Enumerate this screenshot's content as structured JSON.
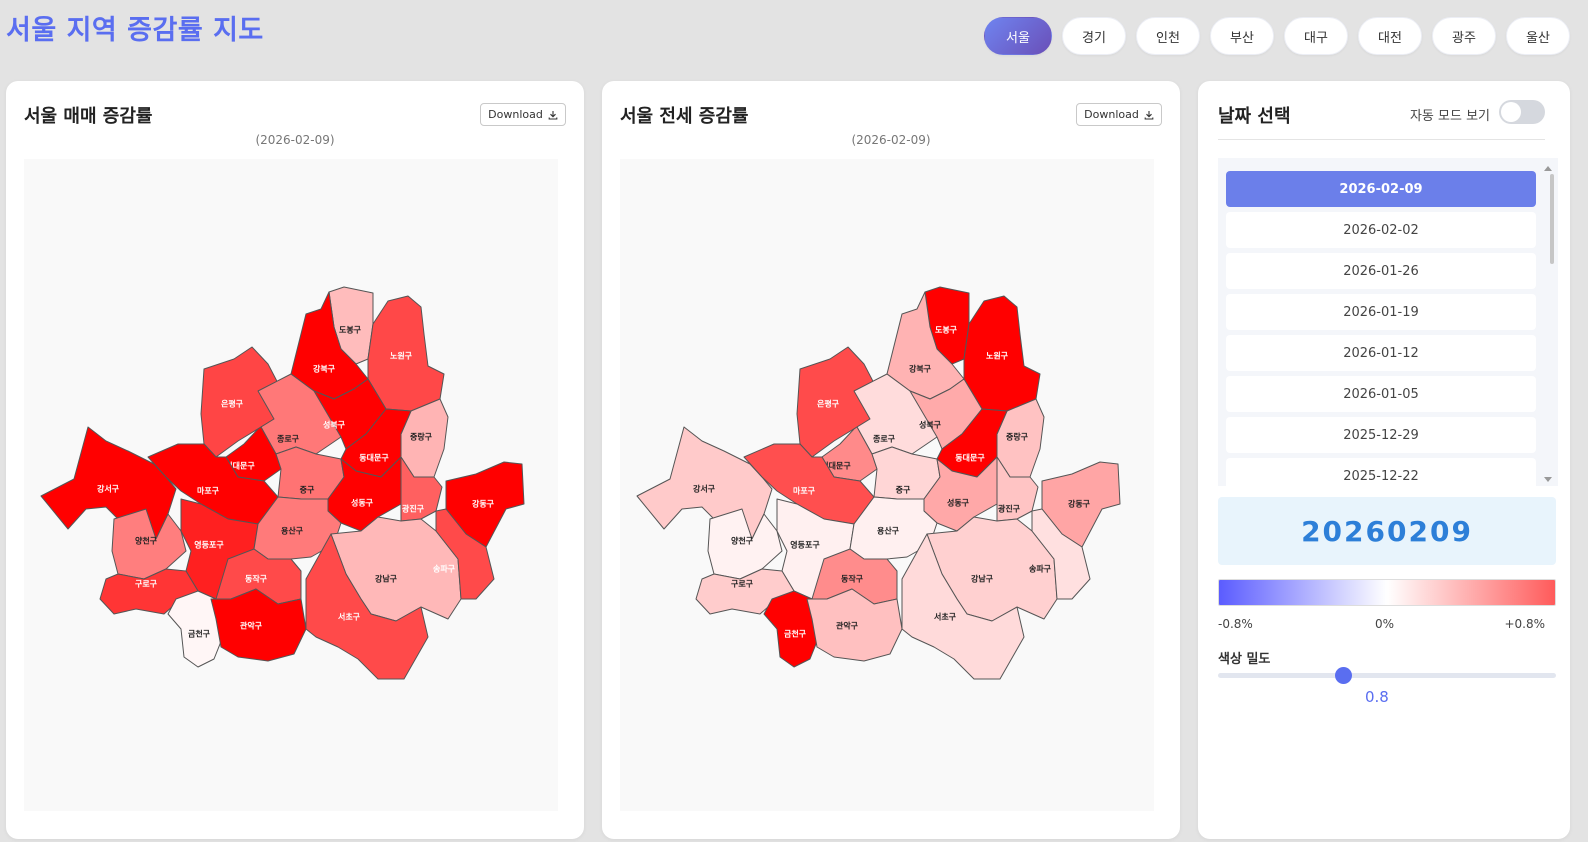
{
  "header": {
    "title": "서울 지역 증감률 지도",
    "regions": [
      "서울",
      "경기",
      "인천",
      "부산",
      "대구",
      "대전",
      "광주",
      "울산"
    ],
    "active_region": "서울"
  },
  "maps": [
    {
      "title": "서울 매매 증감률",
      "download_label": "Download",
      "date": "(2026-02-09)",
      "districts": [
        {
          "id": "dobong",
          "name": "도봉구",
          "color": "#ffbcbc",
          "label_color": "#222"
        },
        {
          "id": "nowon",
          "name": "노원구",
          "color": "#ff4848",
          "label_color": "#fff"
        },
        {
          "id": "gangbuk",
          "name": "강북구",
          "color": "#ff0000",
          "label_color": "#fff"
        },
        {
          "id": "eunpyeong",
          "name": "은평구",
          "color": "#ff4545",
          "label_color": "#fff"
        },
        {
          "id": "jongno",
          "name": "종로구",
          "color": "#ff7878",
          "label_color": "#222"
        },
        {
          "id": "seongbuk",
          "name": "성북구",
          "color": "#ff0000",
          "label_color": "#fff"
        },
        {
          "id": "jungnang",
          "name": "중랑구",
          "color": "#ffb4b4",
          "label_color": "#222"
        },
        {
          "id": "dongdaemun",
          "name": "동대문구",
          "color": "#ff0000",
          "label_color": "#fff"
        },
        {
          "id": "seodaemun",
          "name": "서대문구",
          "color": "#ff0000",
          "label_color": "#fff"
        },
        {
          "id": "gangseo",
          "name": "강서구",
          "color": "#ff0000",
          "label_color": "#fff"
        },
        {
          "id": "mapo",
          "name": "마포구",
          "color": "#ff0000",
          "label_color": "#fff"
        },
        {
          "id": "jung",
          "name": "중구",
          "color": "#ff7373",
          "label_color": "#222"
        },
        {
          "id": "seongdong",
          "name": "성동구",
          "color": "#ff0000",
          "label_color": "#fff"
        },
        {
          "id": "gwangjin",
          "name": "광진구",
          "color": "#ff6060",
          "label_color": "#fff"
        },
        {
          "id": "gangdong",
          "name": "강동구",
          "color": "#ff0000",
          "label_color": "#fff"
        },
        {
          "id": "yangcheon",
          "name": "양천구",
          "color": "#ff7e7e",
          "label_color": "#222"
        },
        {
          "id": "yeongdeungpo",
          "name": "영등포구",
          "color": "#ff2020",
          "label_color": "#fff"
        },
        {
          "id": "yongsan",
          "name": "용산구",
          "color": "#ff7a7a",
          "label_color": "#222"
        },
        {
          "id": "guro",
          "name": "구로구",
          "color": "#ff3535",
          "label_color": "#fff"
        },
        {
          "id": "dongjak",
          "name": "동작구",
          "color": "#ff4a4a",
          "label_color": "#fff"
        },
        {
          "id": "gangnam",
          "name": "강남구",
          "color": "#ffb8b8",
          "label_color": "#222"
        },
        {
          "id": "songpa",
          "name": "송파구",
          "color": "#ff4a4a",
          "label_color": "#fff"
        },
        {
          "id": "geumcheon",
          "name": "금천구",
          "color": "#fff6f6",
          "label_color": "#222"
        },
        {
          "id": "gwanak",
          "name": "관악구",
          "color": "#ff0000",
          "label_color": "#fff"
        },
        {
          "id": "seocho",
          "name": "서초구",
          "color": "#ff4a4a",
          "label_color": "#fff"
        }
      ]
    },
    {
      "title": "서울 전세 증감률",
      "download_label": "Download",
      "date": "(2026-02-09)",
      "districts": [
        {
          "id": "dobong",
          "name": "도봉구",
          "color": "#ff0000",
          "label_color": "#fff"
        },
        {
          "id": "nowon",
          "name": "노원구",
          "color": "#ff0000",
          "label_color": "#fff"
        },
        {
          "id": "gangbuk",
          "name": "강북구",
          "color": "#ffb3b3",
          "label_color": "#222"
        },
        {
          "id": "eunpyeong",
          "name": "은평구",
          "color": "#ff4b4b",
          "label_color": "#fff"
        },
        {
          "id": "jongno",
          "name": "종로구",
          "color": "#ffdcdc",
          "label_color": "#222"
        },
        {
          "id": "seongbuk",
          "name": "성북구",
          "color": "#ffaaaa",
          "label_color": "#222"
        },
        {
          "id": "jungnang",
          "name": "중랑구",
          "color": "#ffc2c2",
          "label_color": "#222"
        },
        {
          "id": "dongdaemun",
          "name": "동대문구",
          "color": "#ff0000",
          "label_color": "#fff"
        },
        {
          "id": "seodaemun",
          "name": "서대문구",
          "color": "#ff8a8a",
          "label_color": "#222"
        },
        {
          "id": "gangseo",
          "name": "강서구",
          "color": "#ffcaca",
          "label_color": "#222"
        },
        {
          "id": "mapo",
          "name": "마포구",
          "color": "#ff4f4f",
          "label_color": "#fff"
        },
        {
          "id": "jung",
          "name": "중구",
          "color": "#ffd6d6",
          "label_color": "#222"
        },
        {
          "id": "seongdong",
          "name": "성동구",
          "color": "#ffa8a8",
          "label_color": "#222"
        },
        {
          "id": "gwangjin",
          "name": "광진구",
          "color": "#ffc4c4",
          "label_color": "#222"
        },
        {
          "id": "gangdong",
          "name": "강동구",
          "color": "#ffa5a5",
          "label_color": "#222"
        },
        {
          "id": "yangcheon",
          "name": "양천구",
          "color": "#fff2f2",
          "label_color": "#222"
        },
        {
          "id": "yeongdeungpo",
          "name": "영등포구",
          "color": "#fff0f0",
          "label_color": "#222"
        },
        {
          "id": "yongsan",
          "name": "용산구",
          "color": "#fff0f0",
          "label_color": "#222"
        },
        {
          "id": "guro",
          "name": "구로구",
          "color": "#ffcccc",
          "label_color": "#222"
        },
        {
          "id": "dongjak",
          "name": "동작구",
          "color": "#ff8c8c",
          "label_color": "#222"
        },
        {
          "id": "gangnam",
          "name": "강남구",
          "color": "#ffd0d0",
          "label_color": "#222"
        },
        {
          "id": "songpa",
          "name": "송파구",
          "color": "#ffe0e0",
          "label_color": "#222"
        },
        {
          "id": "geumcheon",
          "name": "금천구",
          "color": "#ff0000",
          "label_color": "#fff"
        },
        {
          "id": "gwanak",
          "name": "관악구",
          "color": "#ffc0c0",
          "label_color": "#222"
        },
        {
          "id": "seocho",
          "name": "서초구",
          "color": "#ffdada",
          "label_color": "#222"
        }
      ]
    }
  ],
  "sidebar": {
    "title": "날짜 선택",
    "auto_mode_label": "자동 모드 보기",
    "auto_mode_on": false,
    "dates": [
      "2026-02-09",
      "2026-02-02",
      "2026-01-26",
      "2026-01-19",
      "2026-01-12",
      "2026-01-05",
      "2025-12-29",
      "2025-12-22"
    ],
    "selected_date": "2026-02-09",
    "big_date": "20260209",
    "color_scale": {
      "min_label": "-0.8%",
      "mid_label": "0%",
      "max_label": "+0.8%",
      "min_color": "#5b5cff",
      "mid_color": "#ffffff",
      "max_color": "#ff5b5b"
    },
    "density_label": "색상 밀도",
    "density_value": "0.8"
  }
}
